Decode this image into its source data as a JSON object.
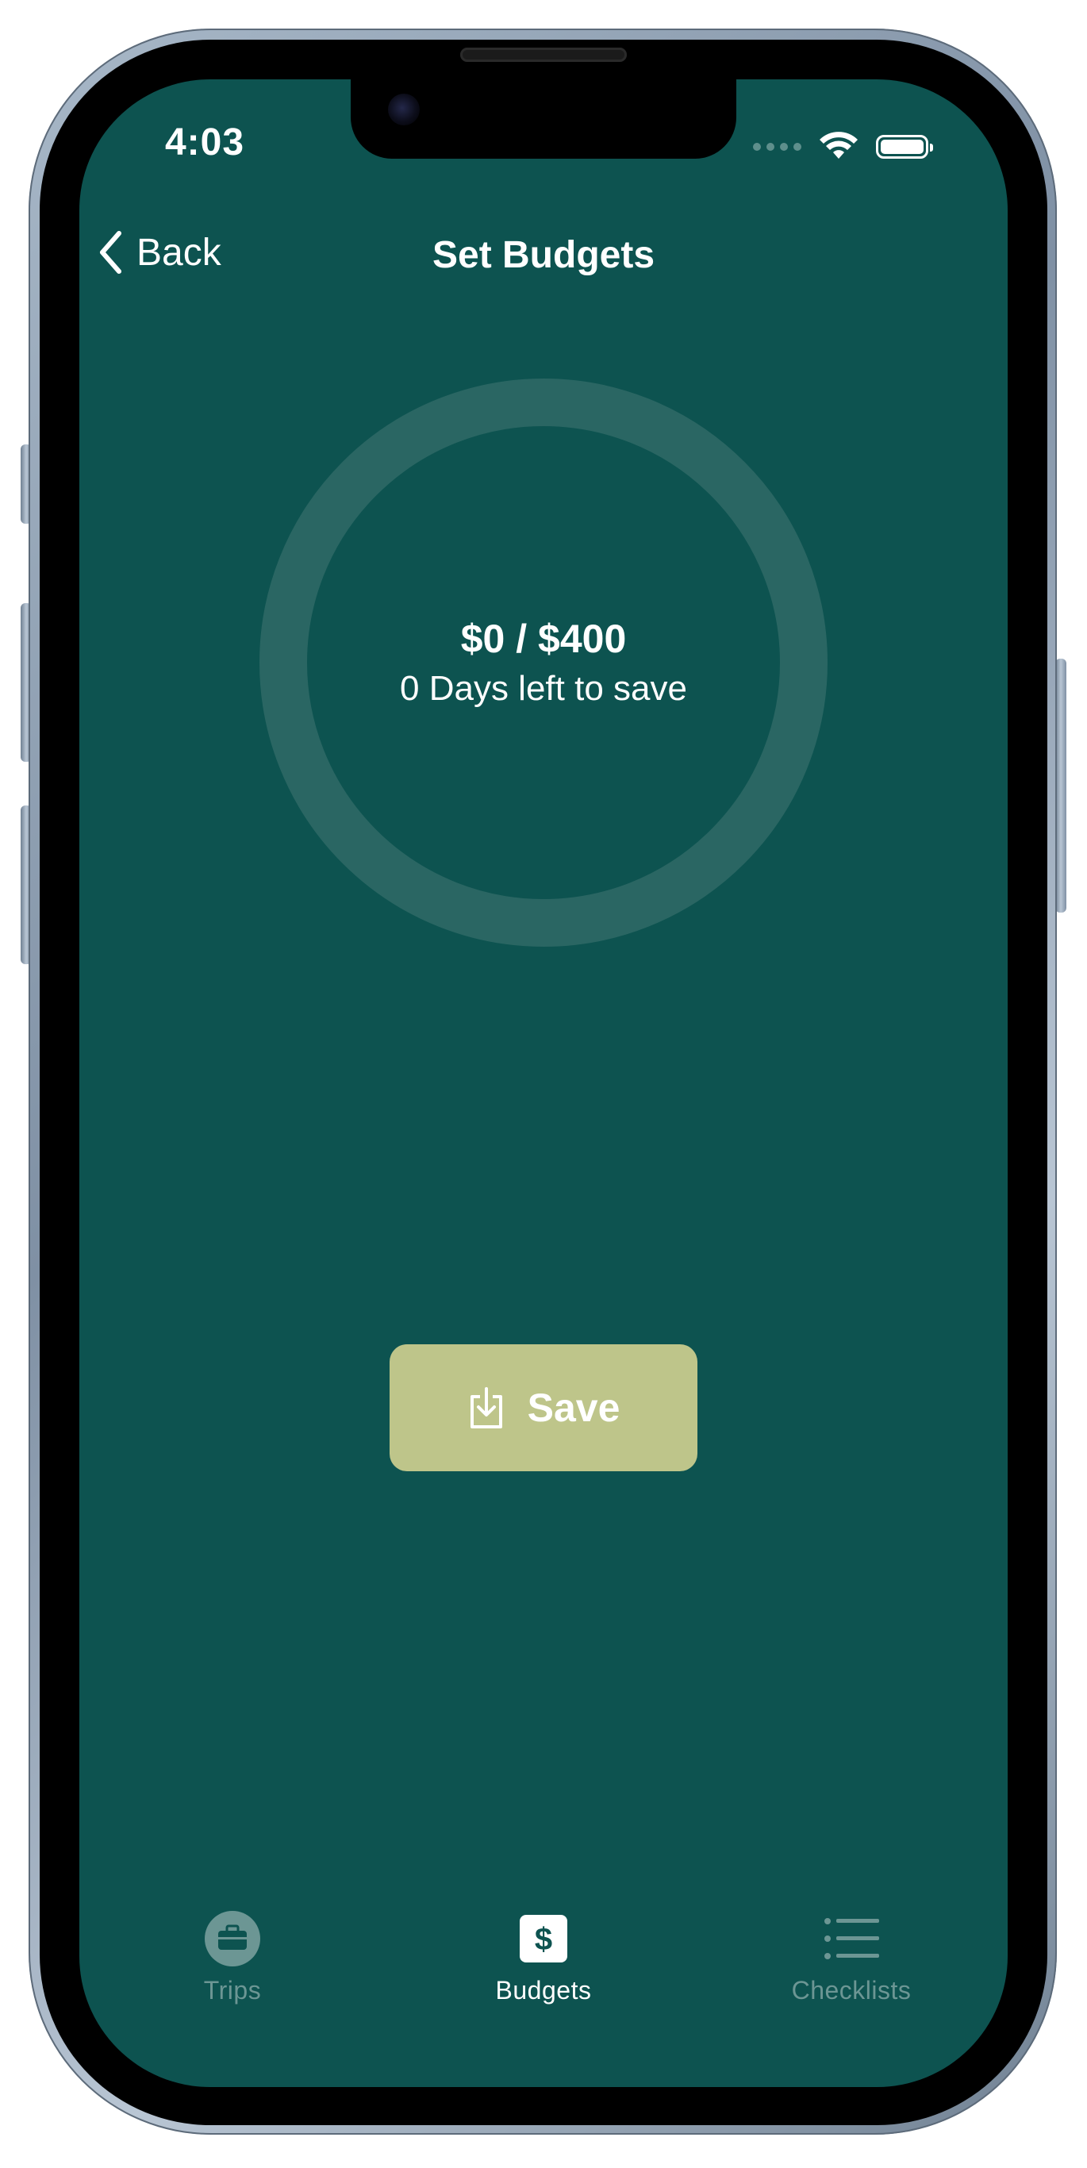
{
  "status_bar": {
    "time": "4:03"
  },
  "nav": {
    "back_label": "Back",
    "title": "Set Budgets"
  },
  "budget": {
    "amount_text": "$0 / $400",
    "days_text": "0 Days left to save",
    "saved": 0,
    "target": 400,
    "progress_fraction": 0
  },
  "actions": {
    "save_label": "Save"
  },
  "tab_bar": {
    "tabs": [
      {
        "label": "Trips",
        "icon": "briefcase-icon",
        "active": false
      },
      {
        "label": "Budgets",
        "icon": "dollar-icon",
        "active": true
      },
      {
        "label": "Checklists",
        "icon": "list-icon",
        "active": false
      }
    ]
  },
  "colors": {
    "background": "#0d5350",
    "ring_track": "#2a6663",
    "save_button": "#bec58a",
    "tab_inactive": "#6c9694",
    "tab_active": "#ffffff"
  }
}
